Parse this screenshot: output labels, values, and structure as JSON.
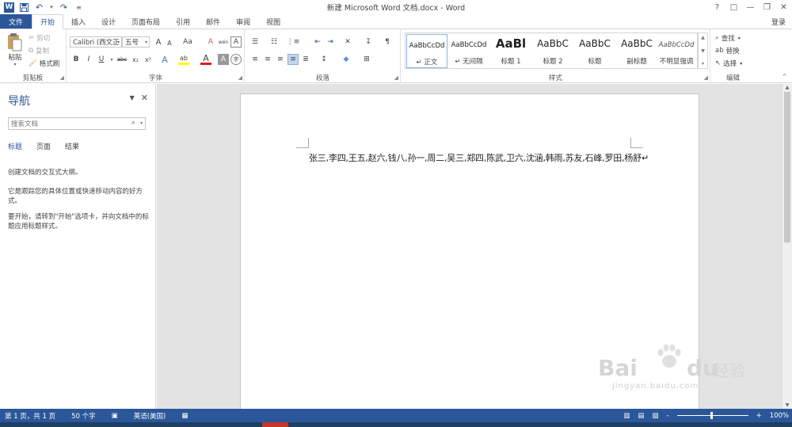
{
  "titlebar": {
    "title": "新建 Microsoft Word 文档.docx - Word",
    "logo": "W",
    "icons": [
      "word-logo-icon",
      "save-icon",
      "undo-icon",
      "redo-icon",
      "customize-qat-icon"
    ],
    "help": "?",
    "ribbon_opts": "□",
    "minimize": "—",
    "restore": "❐",
    "close": "✕"
  },
  "tabs": {
    "file": "文件",
    "items": [
      "开始",
      "插入",
      "设计",
      "页面布局",
      "引用",
      "邮件",
      "审阅",
      "视图"
    ],
    "active": "开始",
    "login": "登录"
  },
  "ribbon": {
    "clipboard": {
      "label": "剪贴板",
      "paste": "粘贴",
      "cut": "剪切",
      "copy": "复制",
      "format_painter": "格式刷"
    },
    "font": {
      "label": "字体",
      "font_name": "Calibri (西文正",
      "font_size": "五号",
      "grow": "A",
      "shrink": "A",
      "case": "Aa",
      "clear": "A",
      "phonetic": "wén",
      "border": "A",
      "bold": "B",
      "italic": "I",
      "underline": "U",
      "strike": "abc",
      "subscript": "x₂",
      "superscript": "x²",
      "effects": "A",
      "highlight": "ab",
      "color": "A",
      "shading": "A",
      "enclose": "字"
    },
    "paragraph": {
      "label": "段落"
    },
    "styles": {
      "label": "样式",
      "items": [
        {
          "sample": "AaBbCcDd",
          "name": "↵ 正文"
        },
        {
          "sample": "AaBbCcDd",
          "name": "↵ 无间隔"
        },
        {
          "sample": "AaBl",
          "name": "标题 1"
        },
        {
          "sample": "AaBbC",
          "name": "标题 2"
        },
        {
          "sample": "AaBbC",
          "name": "标题"
        },
        {
          "sample": "AaBbC",
          "name": "副标题"
        },
        {
          "sample": "AaBbCcDd",
          "name": "不明显强调"
        }
      ]
    },
    "editing": {
      "label": "编辑",
      "find": "查找",
      "replace": "替换",
      "select": "选择"
    }
  },
  "nav": {
    "title": "导航",
    "search_placeholder": "搜索文档",
    "tabs": [
      "标题",
      "页面",
      "结果"
    ],
    "p1": "创建文档的交互式大纲。",
    "p2": "它是跟踪您的具体位置或快速移动内容的好方式。",
    "p3": "要开始，请转到\"开始\"选项卡，并向文档中的标题应用标题样式。"
  },
  "document": {
    "text": "张三,李四,王五,赵六,钱八,孙一,周二,吴三,郑四,陈武,卫六,沈涵,韩雨,苏友,石峰,罗田,杨舒↵"
  },
  "watermark": {
    "brand": "Bai",
    "brand2": "du",
    "cn": "经验",
    "url": "jingyan.baidu.com"
  },
  "status": {
    "page": "第 1 页，共 1 页",
    "words": "50 个字",
    "lang": "英语(美国)",
    "zoom": "100%",
    "zoom_minus": "-",
    "zoom_plus": "+"
  },
  "colors": {
    "accent": "#2b579a",
    "highlight_yellow": "#ffff00",
    "font_red": "#e51b1b"
  }
}
